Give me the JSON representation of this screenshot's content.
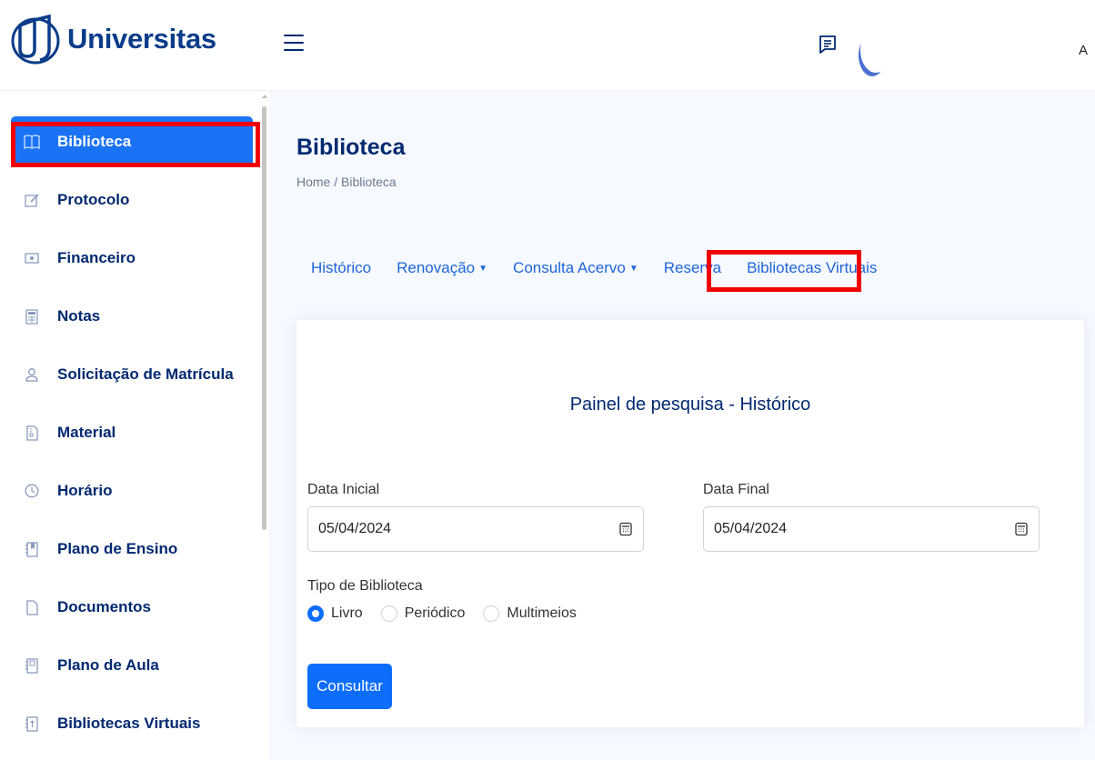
{
  "app": {
    "logo_text": "Universitas",
    "user_initial": "A"
  },
  "sidebar": {
    "items": [
      {
        "label": "Biblioteca",
        "icon": "book-icon"
      },
      {
        "label": "Protocolo",
        "icon": "edit-icon"
      },
      {
        "label": "Financeiro",
        "icon": "money-icon"
      },
      {
        "label": "Notas",
        "icon": "calculator-icon"
      },
      {
        "label": "Solicitação de Matrícula",
        "icon": "person-icon"
      },
      {
        "label": "Material",
        "icon": "file-zip-icon"
      },
      {
        "label": "Horário",
        "icon": "clock-icon"
      },
      {
        "label": "Plano de Ensino",
        "icon": "journal-bookmark-icon"
      },
      {
        "label": "Documentos",
        "icon": "file-icon"
      },
      {
        "label": "Plano de Aula",
        "icon": "journal-icon"
      },
      {
        "label": "Bibliotecas Virtuais",
        "icon": "journal-arrow-icon"
      }
    ],
    "active_index": 0
  },
  "page": {
    "title": "Biblioteca",
    "breadcrumb": "Home / Biblioteca"
  },
  "tabs": [
    {
      "label": "Histórico",
      "dropdown": false
    },
    {
      "label": "Renovação",
      "dropdown": true
    },
    {
      "label": "Consulta Acervo",
      "dropdown": true
    },
    {
      "label": "Reserva",
      "dropdown": false
    },
    {
      "label": "Bibliotecas Virtuais",
      "dropdown": false
    }
  ],
  "panel": {
    "title": "Painel de pesquisa - Histórico",
    "data_inicial_label": "Data Inicial",
    "data_inicial_value": "05/04/2024",
    "data_final_label": "Data Final",
    "data_final_value": "05/04/2024",
    "tipo_label": "Tipo de Biblioteca",
    "tipo_options": [
      "Livro",
      "Periódico",
      "Multimeios"
    ],
    "tipo_selected": "Livro",
    "submit_label": "Consultar"
  },
  "colors": {
    "accent": "#0d6efd",
    "sidebar_active": "#1a73f5",
    "highlight": "#f00000",
    "navy": "#012970"
  }
}
